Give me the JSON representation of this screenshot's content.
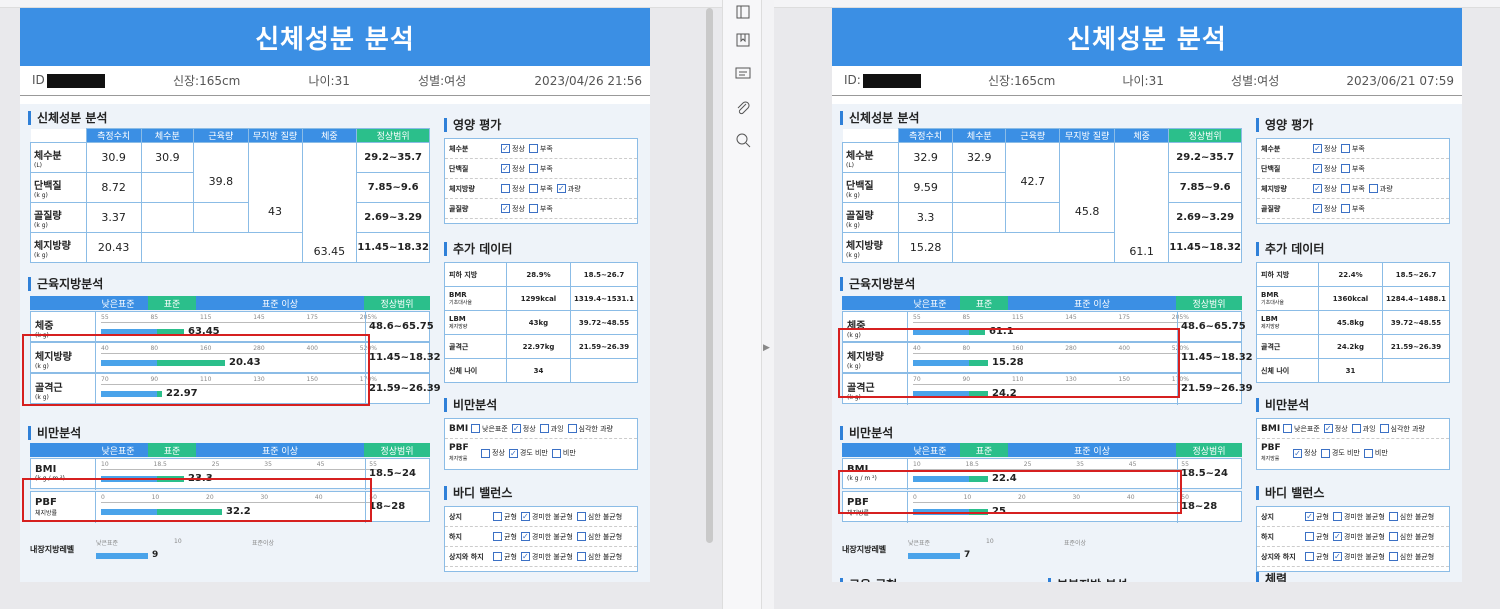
{
  "colors": {
    "header": "#3b8fe4",
    "green": "#2bbf8b",
    "bar": "#4aa3ea",
    "highlight": "#d62020"
  },
  "icons": {
    "sidebar": [
      "panel-icon",
      "bookmark-icon",
      "comment-icon",
      "attach-icon",
      "search-icon"
    ]
  },
  "left": {
    "title": "신체성분 분석",
    "id_label": "ID",
    "height": "신장:165cm",
    "age": "나이:31",
    "sex": "성별:여성",
    "date": "2023/04/26 21:56",
    "comp": {
      "section": "신체성분 분석",
      "headers": [
        "측정수치",
        "체수분",
        "근육량",
        "무지방 질량",
        "체중",
        "정상범위"
      ],
      "rows": [
        {
          "name": "체수분",
          "unit": "(L)",
          "value": "30.9",
          "range": "29.2~35.7"
        },
        {
          "name": "단백질",
          "unit": "(k g)",
          "value": "8.72",
          "range": "7.85~9.6"
        },
        {
          "name": "골질량",
          "unit": "(k g)",
          "value": "3.37",
          "range": "2.69~3.29"
        },
        {
          "name": "체지방량",
          "unit": "(k g)",
          "value": "20.43",
          "range": "11.45~18.32"
        }
      ],
      "water": "30.9",
      "muscle": "39.8",
      "ffm": "43",
      "weight": "63.45"
    },
    "muscle": {
      "section": "근육지방분석",
      "h1": "낮은표준",
      "h2": "표준",
      "h3": "표준 이상",
      "h4": "정상범위",
      "rows": [
        {
          "name": "체중",
          "unit": "(k g)",
          "ticks": [
            "55",
            "85",
            "115",
            "145",
            "175",
            "205%"
          ],
          "value": "63.45",
          "fill": 0.3,
          "range": "48.6~65.75"
        },
        {
          "name": "체지방량",
          "unit": "(k g)",
          "ticks": [
            "40",
            "80",
            "160",
            "280",
            "400",
            "520%"
          ],
          "value": "20.43",
          "fill": 0.45,
          "range": "11.45~18.32"
        },
        {
          "name": "골격근",
          "unit": "(k g)",
          "ticks": [
            "70",
            "90",
            "110",
            "130",
            "150",
            "170%"
          ],
          "value": "22.97",
          "fill": 0.22,
          "range": "21.59~26.39"
        }
      ]
    },
    "obesity": {
      "section": "비만분석",
      "rows": [
        {
          "name": "BMI",
          "unit": "(k g / m ²)",
          "ticks": [
            "10",
            "18.5",
            "25",
            "35",
            "45",
            "55"
          ],
          "value": "23.3",
          "fill": 0.3,
          "range": "18.5~24"
        },
        {
          "name": "PBF",
          "unit": "체지방률",
          "ticks": [
            "0",
            "10",
            "20",
            "30",
            "40",
            "50"
          ],
          "value": "32.2",
          "fill": 0.44,
          "range": "18~28"
        }
      ]
    },
    "visceral": {
      "name": "내장지방레벨",
      "ticks": [
        "낮은표준",
        "10",
        "표준이상"
      ],
      "value": "9"
    },
    "nutrition": {
      "section": "영양 평가",
      "rows": [
        {
          "name": "체수분",
          "opts": [
            "정상",
            "부족"
          ],
          "checked": [
            true,
            false
          ]
        },
        {
          "name": "단백질",
          "opts": [
            "정상",
            "부족"
          ],
          "checked": [
            true,
            false
          ]
        },
        {
          "name": "체지방량",
          "opts": [
            "정상",
            "부족",
            "과량"
          ],
          "checked": [
            false,
            false,
            true
          ]
        },
        {
          "name": "골질량",
          "opts": [
            "정상",
            "부족"
          ],
          "checked": [
            true,
            false
          ]
        }
      ]
    },
    "extra": {
      "section": "추가 데이터",
      "rows": [
        {
          "name": "피하 지방",
          "sub": "",
          "v": "28.9%",
          "r": "18.5~26.7"
        },
        {
          "name": "BMR",
          "sub": "기초대사율",
          "v": "1299kcal",
          "r": "1319.4~1531.1"
        },
        {
          "name": "LBM",
          "sub": "제지방량",
          "v": "43kg",
          "r": "39.72~48.55"
        },
        {
          "name": "골격근",
          "sub": "",
          "v": "22.97kg",
          "r": "21.59~26.39"
        },
        {
          "name": "신체 나이",
          "sub": "",
          "v": "34",
          "r": ""
        }
      ]
    },
    "obesity_eval": {
      "section": "비만분석",
      "bmi": "BMI",
      "bmi_opts": [
        "낮은표준",
        "정상",
        "과잉",
        "심각한 과량"
      ],
      "bmi_checked": [
        false,
        true,
        false,
        false
      ],
      "pbf": "PBF",
      "pbf_sub": "체지방률",
      "pbf_opts": [
        "정상",
        "경도 비만",
        "비만"
      ],
      "pbf_checked": [
        false,
        true,
        false
      ]
    },
    "balance": {
      "section": "바디 밸런스",
      "rows": [
        {
          "name": "상지",
          "checked": [
            false,
            true,
            false
          ]
        },
        {
          "name": "하지",
          "checked": [
            false,
            true,
            false
          ]
        },
        {
          "name": "상지와 하지",
          "checked": [
            false,
            true,
            false
          ]
        }
      ],
      "opts": [
        "균형",
        "경미한 불균형",
        "심한 불균형"
      ]
    }
  },
  "right": {
    "title": "신체성분 분석",
    "id_label": "ID:",
    "height": "신장:165cm",
    "age": "나이:31",
    "sex": "성별:여성",
    "date": "2023/06/21 07:59",
    "comp": {
      "section": "신체성분 분석",
      "headers": [
        "측정수치",
        "체수분",
        "근육량",
        "무지방 질량",
        "체중",
        "정상범위"
      ],
      "rows": [
        {
          "name": "체수분",
          "unit": "(L)",
          "value": "32.9",
          "range": "29.2~35.7"
        },
        {
          "name": "단백질",
          "unit": "(k g)",
          "value": "9.59",
          "range": "7.85~9.6"
        },
        {
          "name": "골질량",
          "unit": "(k g)",
          "value": "3.3",
          "range": "2.69~3.29"
        },
        {
          "name": "체지방량",
          "unit": "(k g)",
          "value": "15.28",
          "range": "11.45~18.32"
        }
      ],
      "water": "32.9",
      "muscle": "42.7",
      "ffm": "45.8",
      "weight": "61.1"
    },
    "muscle": {
      "section": "근육지방분석",
      "h1": "낮은표준",
      "h2": "표준",
      "h3": "표준 이상",
      "h4": "정상범위",
      "rows": [
        {
          "name": "체중",
          "unit": "(k g)",
          "ticks": [
            "55",
            "85",
            "115",
            "145",
            "175",
            "205%"
          ],
          "value": "61.1",
          "fill": 0.26,
          "range": "48.6~65.75"
        },
        {
          "name": "체지방량",
          "unit": "(k g)",
          "ticks": [
            "40",
            "80",
            "160",
            "280",
            "400",
            "520%"
          ],
          "value": "15.28",
          "fill": 0.27,
          "range": "11.45~18.32"
        },
        {
          "name": "골격근",
          "unit": "(k g)",
          "ticks": [
            "70",
            "90",
            "110",
            "130",
            "150",
            "170%"
          ],
          "value": "24.2",
          "fill": 0.27,
          "range": "21.59~26.39"
        }
      ]
    },
    "obesity": {
      "section": "비만분석",
      "rows": [
        {
          "name": "BMI",
          "unit": "(k g / m ²)",
          "ticks": [
            "10",
            "18.5",
            "25",
            "35",
            "45",
            "55"
          ],
          "value": "22.4",
          "fill": 0.27,
          "range": "18.5~24"
        },
        {
          "name": "PBF",
          "unit": "체지방률",
          "ticks": [
            "0",
            "10",
            "20",
            "30",
            "40",
            "50"
          ],
          "value": "25",
          "fill": 0.27,
          "range": "18~28"
        }
      ]
    },
    "visceral": {
      "name": "내장지방레벨",
      "ticks": [
        "낮은표준",
        "10",
        "표준이상"
      ],
      "value": "7"
    },
    "nutrition": {
      "section": "영양 평가",
      "rows": [
        {
          "name": "체수분",
          "opts": [
            "정상",
            "부족"
          ],
          "checked": [
            true,
            false
          ]
        },
        {
          "name": "단백질",
          "opts": [
            "정상",
            "부족"
          ],
          "checked": [
            true,
            false
          ]
        },
        {
          "name": "체지방량",
          "opts": [
            "정상",
            "부족",
            "과량"
          ],
          "checked": [
            true,
            false,
            false
          ]
        },
        {
          "name": "골질량",
          "opts": [
            "정상",
            "부족"
          ],
          "checked": [
            true,
            false
          ]
        }
      ]
    },
    "extra": {
      "section": "추가 데이터",
      "rows": [
        {
          "name": "피하 지방",
          "sub": "",
          "v": "22.4%",
          "r": "18.5~26.7"
        },
        {
          "name": "BMR",
          "sub": "기초대사율",
          "v": "1360kcal",
          "r": "1284.4~1488.1"
        },
        {
          "name": "LBM",
          "sub": "제지방량",
          "v": "45.8kg",
          "r": "39.72~48.55"
        },
        {
          "name": "골격근",
          "sub": "",
          "v": "24.2kg",
          "r": "21.59~26.39"
        },
        {
          "name": "신체 나이",
          "sub": "",
          "v": "31",
          "r": ""
        }
      ]
    },
    "obesity_eval": {
      "section": "비만분석",
      "bmi": "BMI",
      "bmi_opts": [
        "낮은표준",
        "정상",
        "과잉",
        "심각한 과량"
      ],
      "bmi_checked": [
        false,
        true,
        false,
        false
      ],
      "pbf": "PBF",
      "pbf_sub": "체지방률",
      "pbf_opts": [
        "정상",
        "경도 비만",
        "비만"
      ],
      "pbf_checked": [
        true,
        false,
        false
      ]
    },
    "balance": {
      "section": "바디 밸런스",
      "rows": [
        {
          "name": "상지",
          "checked": [
            true,
            false,
            false
          ]
        },
        {
          "name": "하지",
          "checked": [
            false,
            true,
            false
          ]
        },
        {
          "name": "상지와 하지",
          "checked": [
            false,
            true,
            false
          ]
        }
      ],
      "opts": [
        "균형",
        "경미한 불균형",
        "심한 불균형"
      ]
    },
    "bottom": {
      "l1": "근육 균형",
      "l2": "부분지방 분석",
      "l3": "체력"
    }
  }
}
